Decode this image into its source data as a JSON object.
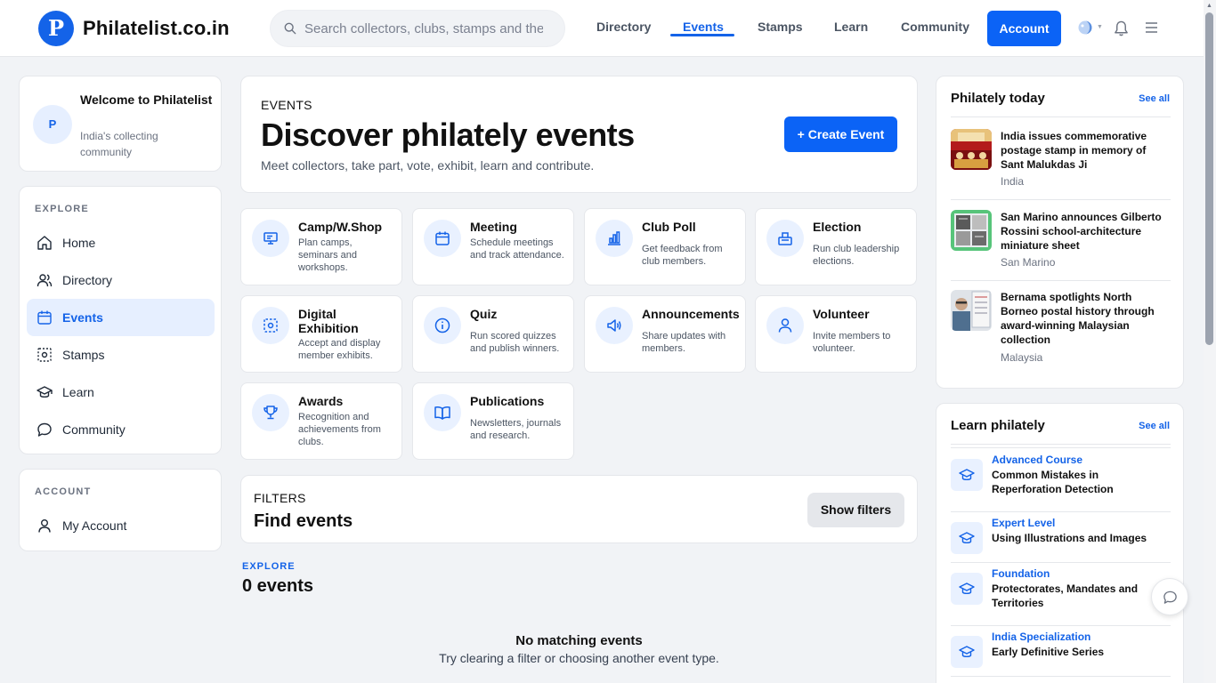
{
  "brand": {
    "logo_letter": "P",
    "name": "Philatelist.co.in"
  },
  "search": {
    "placeholder": "Search collectors, clubs, stamps and themes"
  },
  "nav": {
    "directory": "Directory",
    "events": "Events",
    "stamps": "Stamps",
    "learn": "Learn",
    "community": "Community",
    "account_button": "Account"
  },
  "welcome": {
    "avatar_letter": "P",
    "title": "Welcome to Philatelist",
    "subtitle": "India's collecting community"
  },
  "sidebar": {
    "explore_label": "EXPLORE",
    "items": [
      {
        "label": "Home",
        "icon": "home-icon"
      },
      {
        "label": "Directory",
        "icon": "users-icon"
      },
      {
        "label": "Events",
        "icon": "calendar-icon",
        "active": true
      },
      {
        "label": "Stamps",
        "icon": "stamp-icon"
      },
      {
        "label": "Learn",
        "icon": "graduation-cap-icon"
      },
      {
        "label": "Community",
        "icon": "chat-bubble-icon"
      }
    ],
    "account_label": "ACCOUNT",
    "account_item": "My Account"
  },
  "hero": {
    "eyebrow": "EVENTS",
    "title": "Discover philately events",
    "subtitle": "Meet collectors, take part, vote, exhibit, learn and contribute.",
    "create_button": "+ Create Event"
  },
  "event_types": [
    {
      "title": "Camp/W.Shop",
      "desc": "Plan camps, seminars and workshops.",
      "icon": "presentation-icon"
    },
    {
      "title": "Meeting",
      "desc": "Schedule meetings and track attendance.",
      "icon": "calendar-icon"
    },
    {
      "title": "Club Poll",
      "desc": "Get feedback from club members.",
      "icon": "bar-chart-icon"
    },
    {
      "title": "Election",
      "desc": "Run club leadership elections.",
      "icon": "ballot-box-icon"
    },
    {
      "title": "Digital Exhibition",
      "desc": "Accept and display member exhibits.",
      "icon": "exhibit-frame-icon"
    },
    {
      "title": "Quiz",
      "desc": "Run scored quizzes and publish winners.",
      "icon": "info-icon"
    },
    {
      "title": "Announcements",
      "desc": "Share updates with members.",
      "icon": "megaphone-icon"
    },
    {
      "title": "Volunteer",
      "desc": "Invite members to volunteer.",
      "icon": "person-icon"
    },
    {
      "title": "Awards",
      "desc": "Recognition and achievements from clubs.",
      "icon": "trophy-icon"
    },
    {
      "title": "Publications",
      "desc": "Newsletters, journals and research.",
      "icon": "book-open-icon"
    }
  ],
  "filters": {
    "eyebrow": "FILTERS",
    "title": "Find events",
    "button": "Show filters"
  },
  "results": {
    "explore_label": "EXPLORE",
    "count": "0 events",
    "empty_title": "No matching events",
    "empty_sub": "Try clearing a filter or choosing another event type."
  },
  "philately_today": {
    "title": "Philately today",
    "see_all": "See all",
    "items": [
      {
        "title": "India issues commemorative postage stamp in memory of Sant Malukdas Ji",
        "location": "India"
      },
      {
        "title": "San Marino announces Gilberto Rossini school-architecture miniature sheet",
        "location": "San Marino"
      },
      {
        "title": "Bernama spotlights North Borneo postal history through award-winning Malaysian collection",
        "location": "Malaysia"
      }
    ]
  },
  "learn_philately": {
    "title": "Learn philately",
    "see_all": "See all",
    "items": [
      {
        "level": "Advanced Course",
        "title": "Common Mistakes in Reperforation Detection"
      },
      {
        "level": "Expert Level",
        "title": "Using Illustrations and Images"
      },
      {
        "level": "Foundation",
        "title": "Protectorates, Mandates and Territories"
      },
      {
        "level": "India Specialization",
        "title": "Early Definitive Series"
      }
    ]
  },
  "colors": {
    "accent": "#0b63f6",
    "accent_soft": "#e6efff",
    "page_bg": "#f1f3f6"
  }
}
